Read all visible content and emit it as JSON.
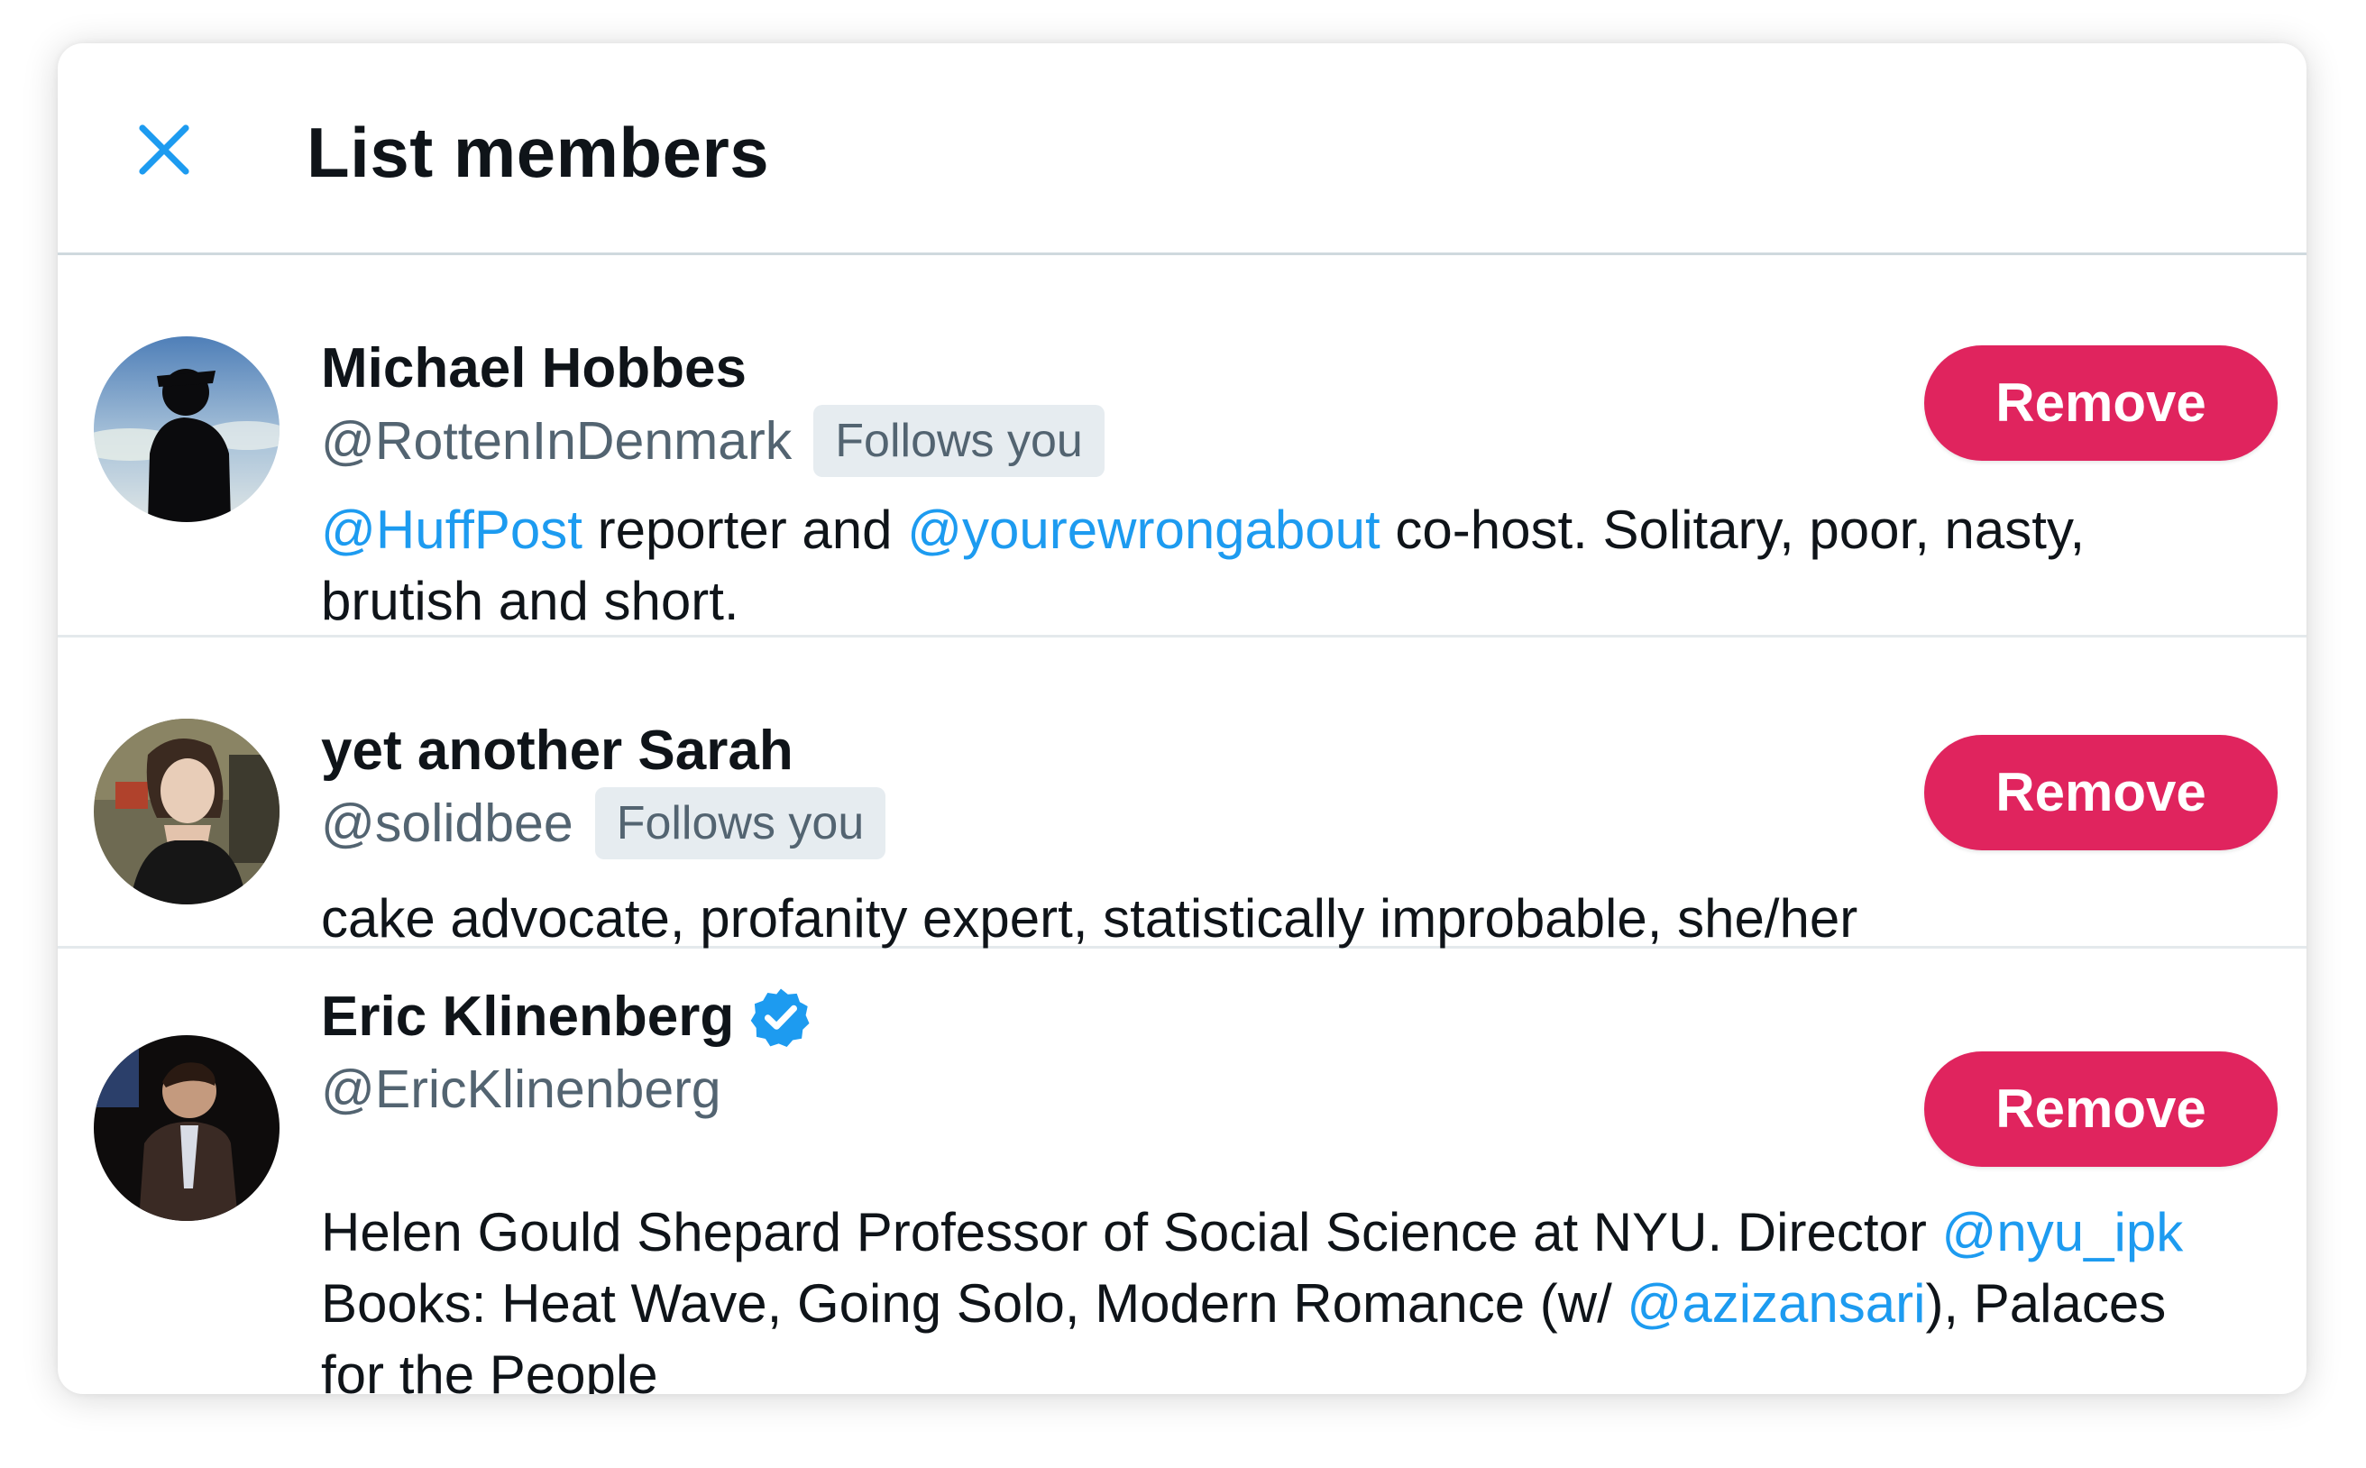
{
  "header": {
    "title": "List members",
    "close_icon": "close-icon"
  },
  "colors": {
    "accent": "#1d9bf0",
    "remove_button": "#e0245e",
    "badge_bg": "#e6ecf0",
    "secondary_text": "#536471"
  },
  "members": [
    {
      "name": "Michael Hobbes",
      "handle": "@RottenInDenmark",
      "follows_you": "Follows you",
      "verified": false,
      "button": "Remove",
      "bio": [
        {
          "text": "@HuffPost",
          "mention": true
        },
        {
          "text": " reporter and ",
          "mention": false
        },
        {
          "text": "@yourewrongabout",
          "mention": true
        },
        {
          "text": " co-host. Solitary, poor, nasty, brutish and short.",
          "mention": false
        }
      ]
    },
    {
      "name": "yet another Sarah",
      "handle": "@solidbee",
      "follows_you": "Follows you",
      "verified": false,
      "button": "Remove",
      "bio": [
        {
          "text": "cake advocate, profanity expert, statistically improbable, she/her",
          "mention": false
        }
      ]
    },
    {
      "name": "Eric Klinenberg",
      "handle": "@EricKlinenberg",
      "verified": true,
      "button": "Remove",
      "bio": [
        {
          "text": "Helen Gould Shepard Professor of Social Science at NYU. Director ",
          "mention": false
        },
        {
          "text": "@nyu_ipk",
          "mention": true
        },
        {
          "text": " Books: Heat Wave, Going Solo, Modern Romance (w/ ",
          "mention": false
        },
        {
          "text": "@azizansari",
          "mention": true
        },
        {
          "text": "), Palaces for the People",
          "mention": false
        }
      ]
    }
  ]
}
